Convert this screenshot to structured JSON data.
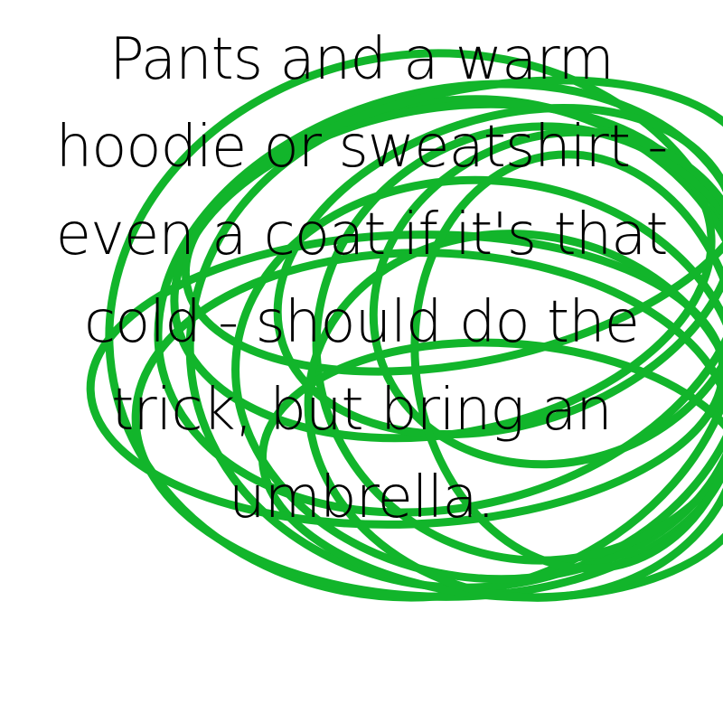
{
  "caption": {
    "text": "Pants and a warm hoodie or sweatshirt - even a coat if it's that cold - should do the trick, but bring an umbrella."
  },
  "scribble": {
    "color": "#12b52b",
    "icon": "green-loop-scribble"
  }
}
